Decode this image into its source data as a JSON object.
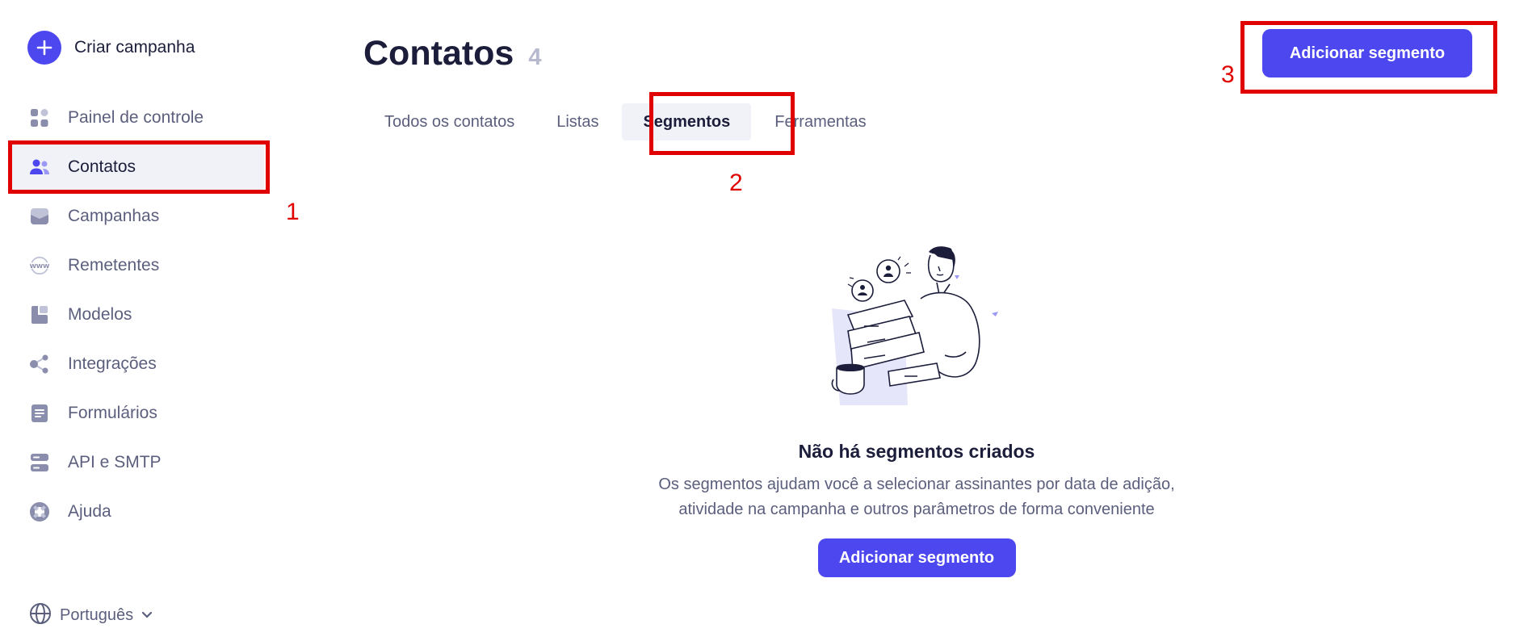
{
  "sidebar": {
    "create_label": "Criar campanha",
    "items": [
      {
        "label": "Painel de controle",
        "icon": "dashboard-icon"
      },
      {
        "label": "Contatos",
        "icon": "contacts-icon",
        "active": true
      },
      {
        "label": "Campanhas",
        "icon": "campaigns-icon"
      },
      {
        "label": "Remetentes",
        "icon": "www-icon"
      },
      {
        "label": "Modelos",
        "icon": "templates-icon"
      },
      {
        "label": "Integrações",
        "icon": "integrations-icon"
      },
      {
        "label": "Formulários",
        "icon": "forms-icon"
      },
      {
        "label": "API e SMTP",
        "icon": "server-icon"
      },
      {
        "label": "Ajuda",
        "icon": "help-icon"
      }
    ],
    "language": "Português"
  },
  "header": {
    "title": "Contatos",
    "count": "4",
    "add_segment_label": "Adicionar segmento"
  },
  "tabs": [
    {
      "label": "Todos os contatos"
    },
    {
      "label": "Listas"
    },
    {
      "label": "Segmentos",
      "active": true
    },
    {
      "label": "Ferramentas"
    }
  ],
  "empty_state": {
    "title": "Não há segmentos criados",
    "description": "Os segmentos ajudam você a selecionar assinantes por data de adição, atividade na campanha e outros parâmetros de forma conveniente",
    "button_label": "Adicionar segmento"
  },
  "annotations": [
    "1",
    "2",
    "3"
  ],
  "colors": {
    "accent": "#4d47f0",
    "highlight": "#e00000",
    "text_dark": "#1b1d3a",
    "text_muted": "#5b5f7d",
    "active_bg": "#f1f2f8"
  }
}
